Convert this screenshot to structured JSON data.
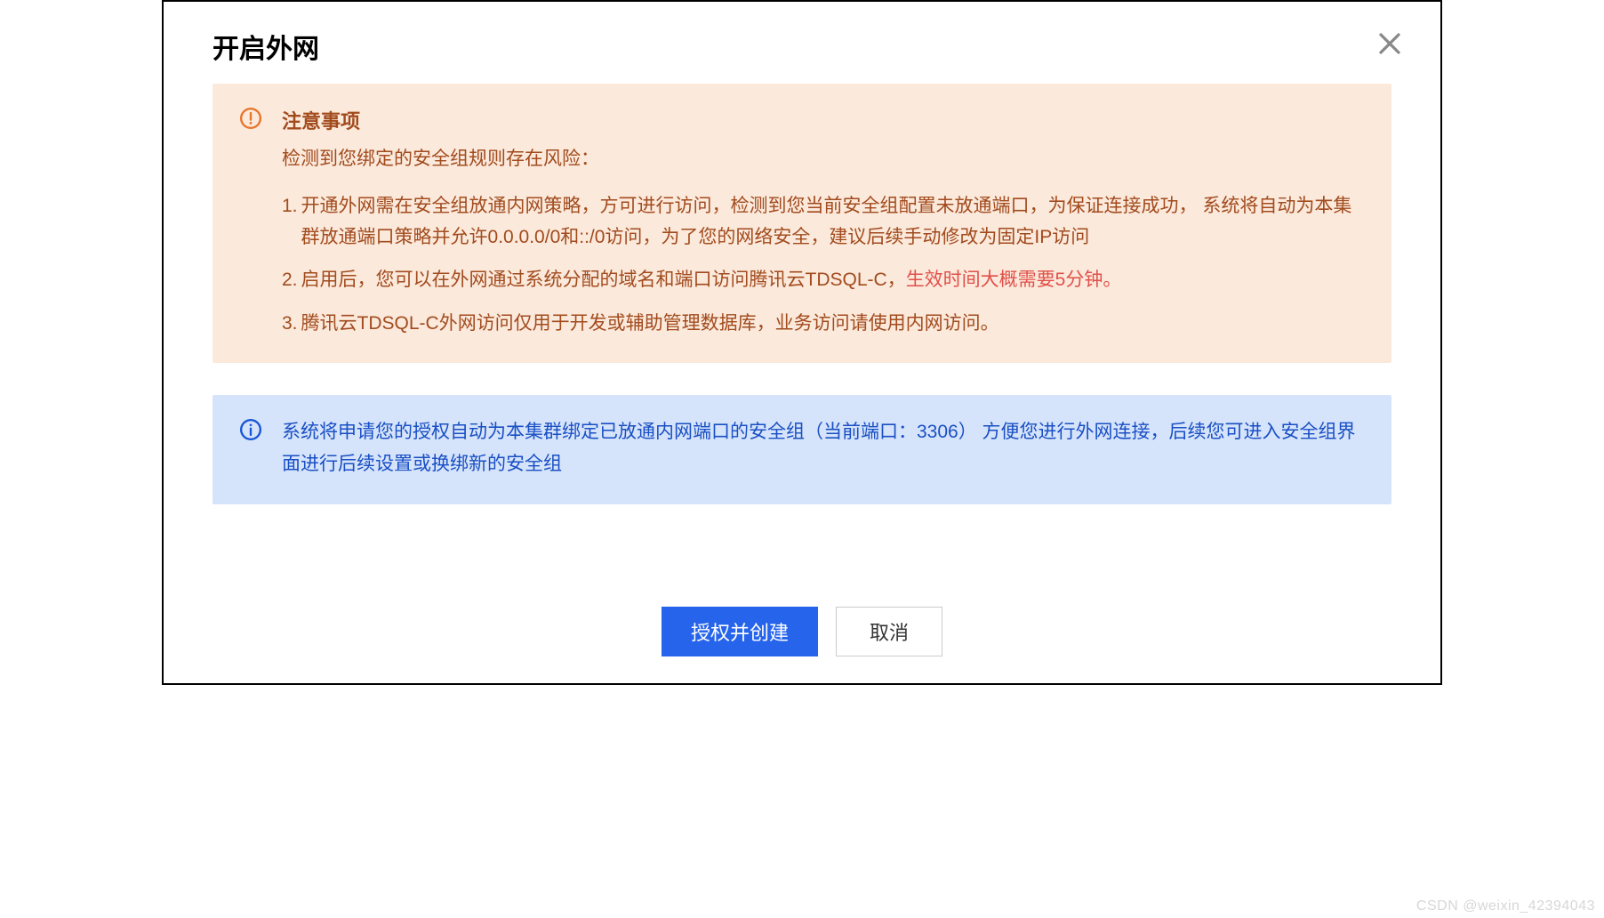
{
  "dialog": {
    "title": "开启外网",
    "close_aria": "关闭"
  },
  "warning": {
    "title": "注意事项",
    "subtitle": "检测到您绑定的安全组规则存在风险：",
    "items": [
      {
        "num": "1.",
        "text": "开通外网需在安全组放通内网策略，方可进行访问，检测到您当前安全组配置未放通端口，为保证连接成功， 系统将自动为本集群放通端口策略并允许0.0.0.0/0和::/0访问，为了您的网络安全，建议后续手动修改为固定IP访问"
      },
      {
        "num": "2.",
        "text_prefix": "启用后，您可以在外网通过系统分配的域名和端口访问腾讯云TDSQL-C，",
        "highlight": "生效时间大概需要5分钟。"
      },
      {
        "num": "3.",
        "text": "腾讯云TDSQL-C外网访问仅用于开发或辅助管理数据库，业务访问请使用内网访问。"
      }
    ]
  },
  "info": {
    "text": "系统将申请您的授权自动为本集群绑定已放通内网端口的安全组（当前端口：3306） 方便您进行外网连接，后续您可进入安全组界面进行后续设置或换绑新的安全组"
  },
  "footer": {
    "primary_label": "授权并创建",
    "cancel_label": "取消"
  },
  "watermark": "CSDN @weixin_42394043"
}
